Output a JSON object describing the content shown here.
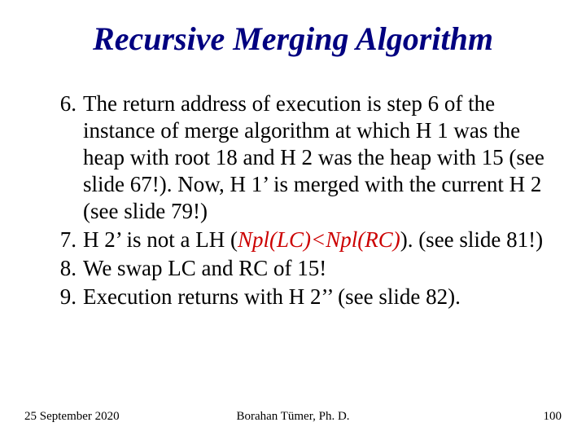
{
  "title": "Recursive Merging Algorithm",
  "items": [
    {
      "text": "The return address of execution is step 6 of the instance of merge algorithm at which H 1 was the heap with root 18 and H 2 was the heap with 15 (see slide 67!).  Now, H 1’ is merged with the current H 2 (see slide 79!)"
    },
    {
      "pre": "H 2’ is not a LH (",
      "red": "Npl(LC)<Npl(RC)",
      "post": "). (see slide 81!)"
    },
    {
      "text": "We swap LC and RC of 15!"
    },
    {
      "text": "Execution returns with H 2’’ (see slide 82)."
    }
  ],
  "footer": {
    "date": "25 September 2020",
    "author": "Borahan Tümer, Ph. D.",
    "page": "100"
  }
}
